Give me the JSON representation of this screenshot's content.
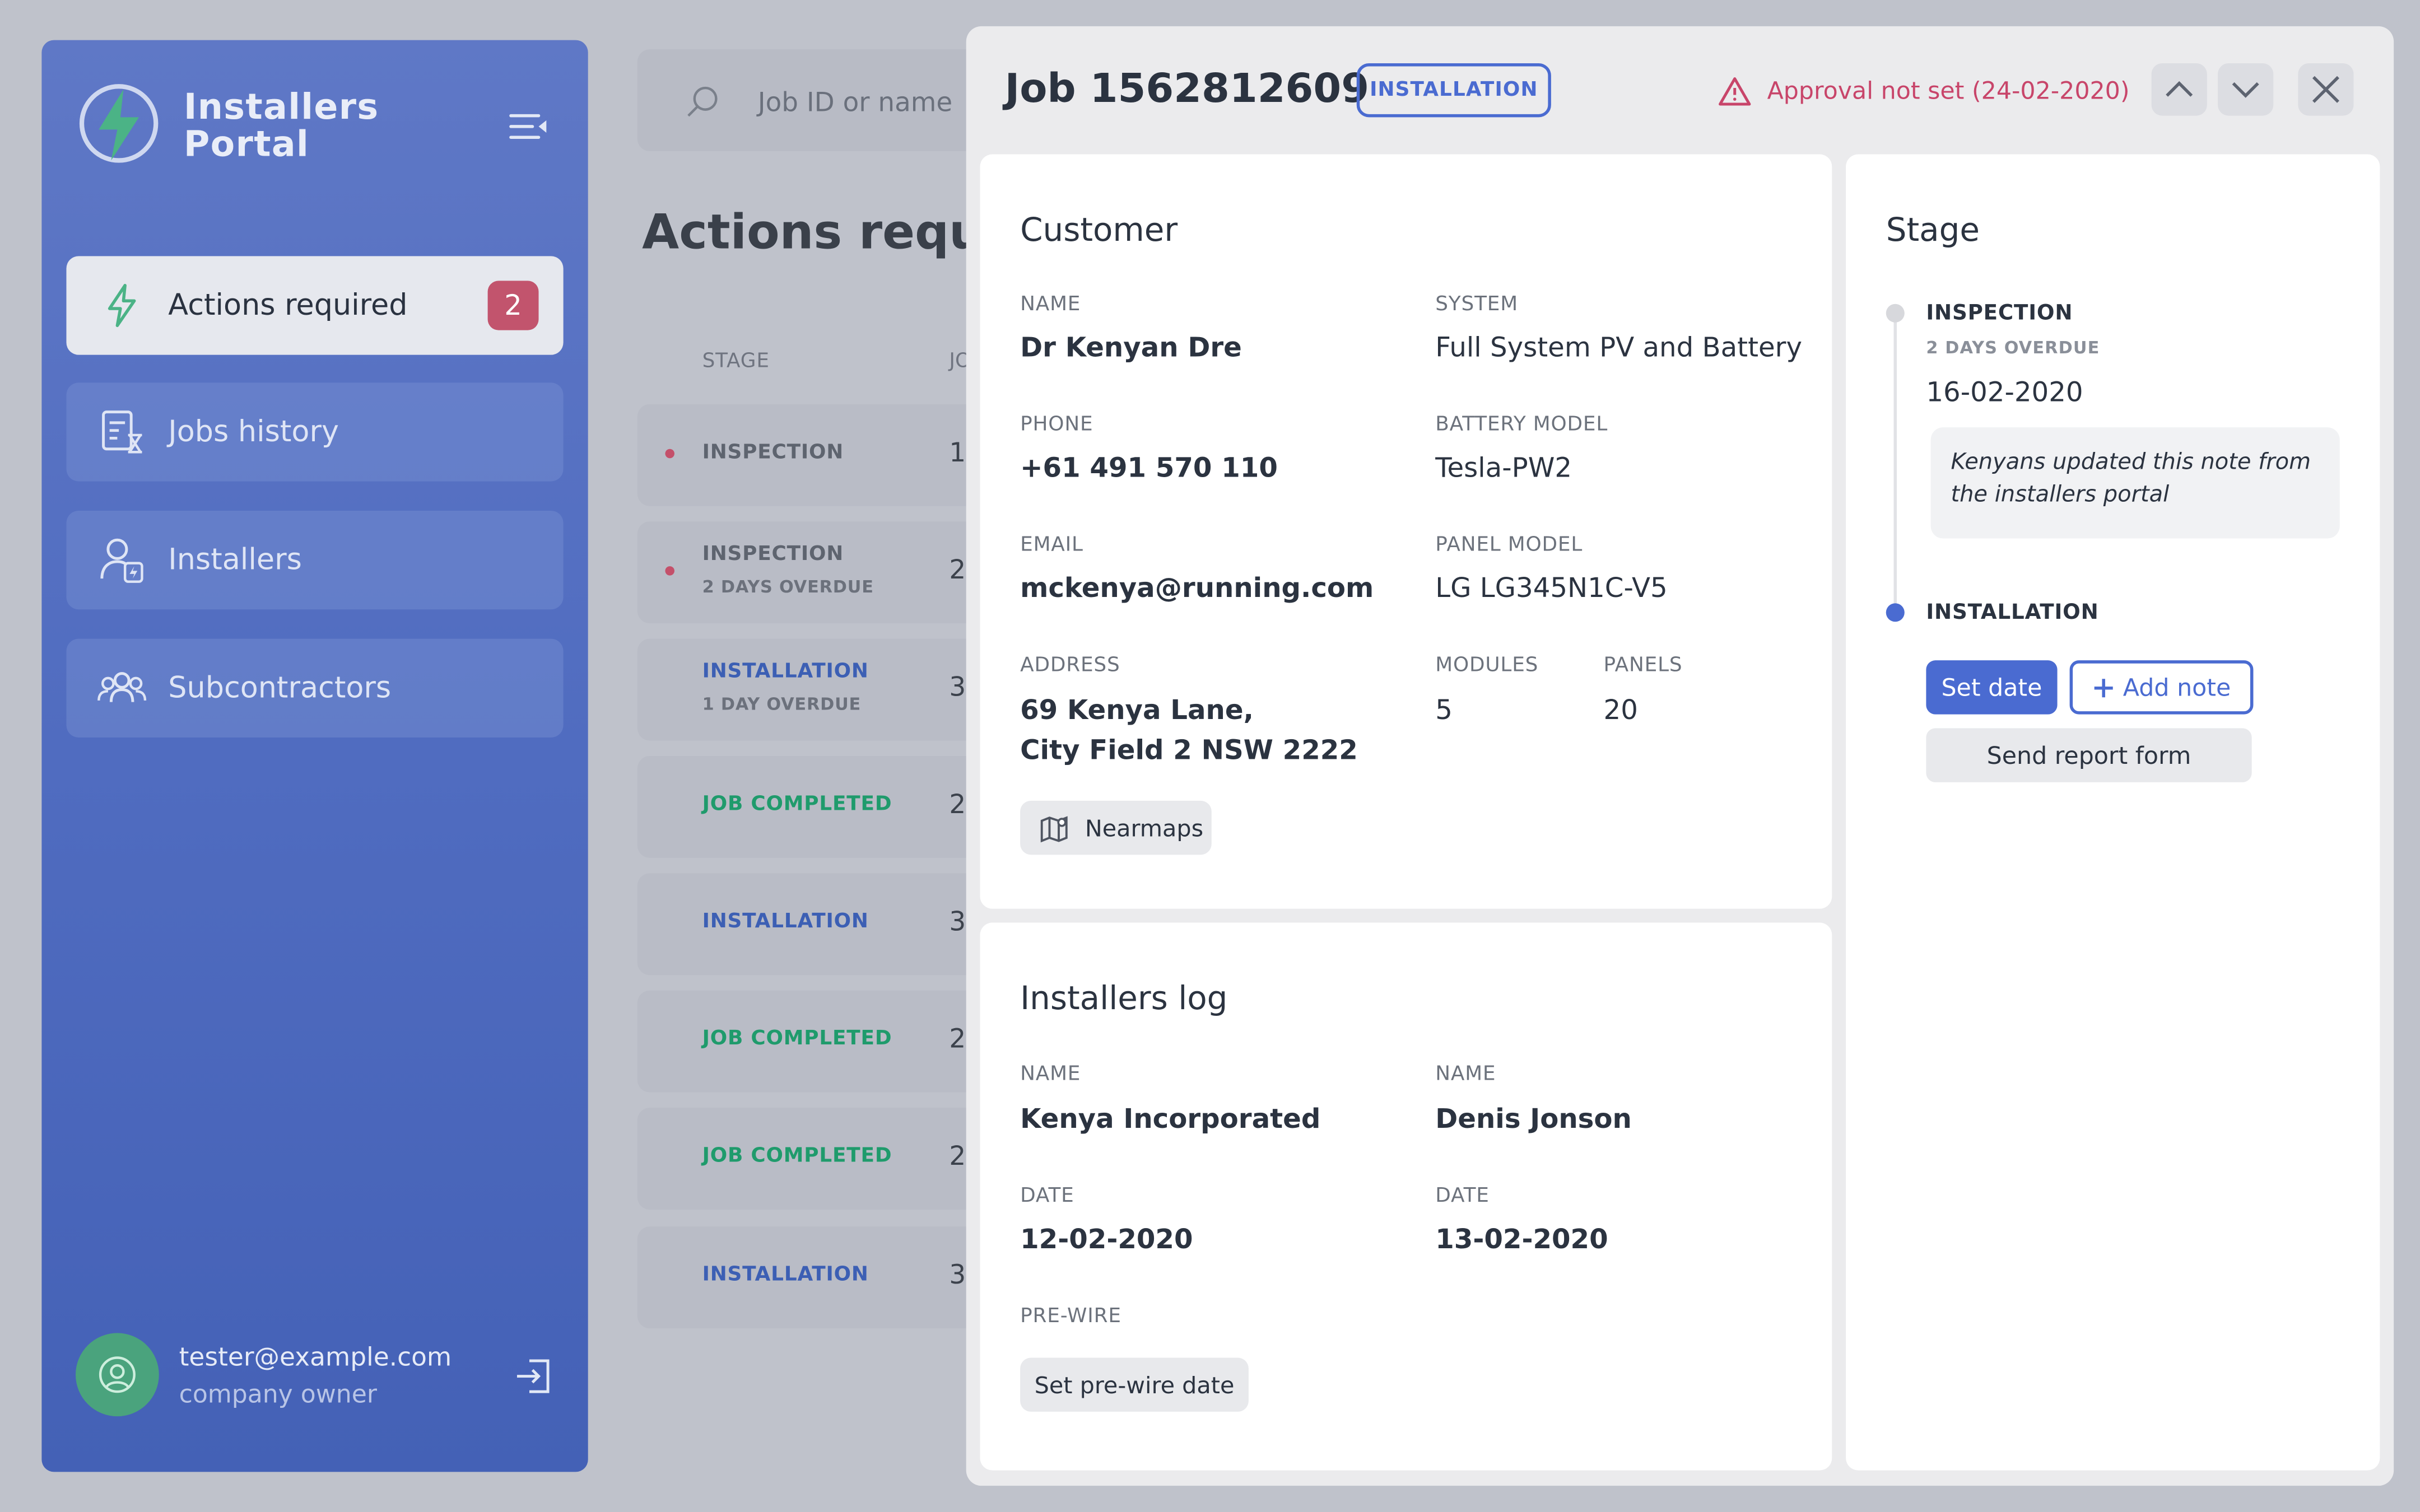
{
  "app": {
    "brand_line1": "Installers",
    "brand_line2": "Portal"
  },
  "sidebar": {
    "items": [
      {
        "label": "Actions required",
        "badge": "2",
        "active": true
      },
      {
        "label": "Jobs history"
      },
      {
        "label": "Installers"
      },
      {
        "label": "Subcontractors"
      }
    ],
    "user": {
      "email": "tester@example.com",
      "role": "company owner"
    }
  },
  "list": {
    "search_placeholder": "Job ID or name",
    "title": "Actions required",
    "columns": {
      "stage": "STAGE",
      "job": "JO"
    },
    "rows": [
      {
        "stage": "INSPECTION",
        "sub": "",
        "num": "1",
        "dot": true,
        "color": "gray"
      },
      {
        "stage": "INSPECTION",
        "sub": "2 DAYS OVERDUE",
        "num": "2",
        "dot": true,
        "color": "gray"
      },
      {
        "stage": "INSTALLATION",
        "sub": "1 DAY OVERDUE",
        "num": "3",
        "dot": false,
        "color": "blue"
      },
      {
        "stage": "JOB COMPLETED",
        "sub": "",
        "num": "2",
        "dot": false,
        "color": "green"
      },
      {
        "stage": "INSTALLATION",
        "sub": "",
        "num": "3",
        "dot": false,
        "color": "blue"
      },
      {
        "stage": "JOB COMPLETED",
        "sub": "",
        "num": "2",
        "dot": false,
        "color": "green"
      },
      {
        "stage": "JOB COMPLETED",
        "sub": "",
        "num": "2",
        "dot": false,
        "color": "green"
      },
      {
        "stage": "INSTALLATION",
        "sub": "",
        "num": "3",
        "dot": false,
        "color": "blue"
      }
    ]
  },
  "modal": {
    "title": "Job 1562812609",
    "type_badge": "INSTALLATION",
    "warning": "Approval not set (24-02-2020)",
    "customer": {
      "heading": "Customer",
      "name_label": "NAME",
      "name": "Dr Kenyan Dre",
      "system_label": "SYSTEM",
      "system": "Full System PV and Battery",
      "phone_label": "PHONE",
      "phone": "+61 491 570 110",
      "battery_label": "BATTERY MODEL",
      "battery": "Tesla-PW2",
      "email_label": "EMAIL",
      "email": "mckenya@running.com",
      "panel_label": "PANEL MODEL",
      "panel": "LG LG345N1C-V5",
      "address_label": "ADDRESS",
      "address_line1": "69 Kenya Lane,",
      "address_line2": "City Field 2 NSW 2222",
      "modules_label": "MODULES",
      "modules": "5",
      "panels_label": "PANELS",
      "panels": "20",
      "nearmaps": "Nearmaps"
    },
    "log": {
      "heading": "Installers log",
      "name1_label": "NAME",
      "name1": "Kenya Incorporated",
      "name2_label": "NAME",
      "name2": "Denis Jonson",
      "date1_label": "DATE",
      "date1": "12-02-2020",
      "date2_label": "DATE",
      "date2": "13-02-2020",
      "prewire_label": "PRE-WIRE",
      "prewire_button": "Set pre-wire date"
    },
    "stage": {
      "heading": "Stage",
      "inspection": {
        "label": "INSPECTION",
        "sub": "2 DAYS OVERDUE",
        "date": "16-02-2020",
        "note": "Kenyans updated this note from the installers portal"
      },
      "installation": {
        "label": "INSTALLATION"
      },
      "set_date": "Set date",
      "add_note": "Add note",
      "send_report": "Send report form"
    }
  },
  "colors": {
    "accent": "#4a6bd1",
    "warning": "#c8456a",
    "success": "#1f9b6c",
    "badge": "#c2546d"
  }
}
